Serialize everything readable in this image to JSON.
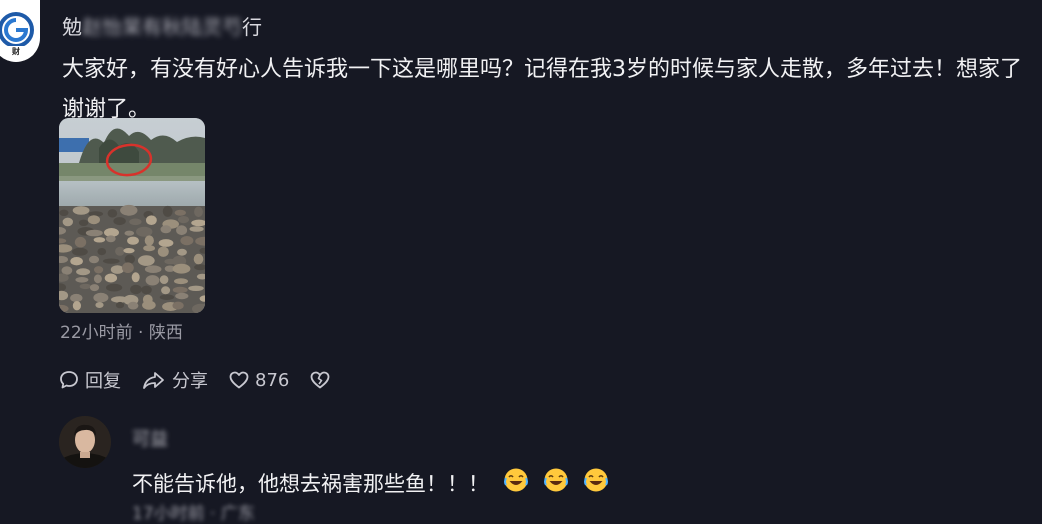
{
  "post": {
    "username_clear": "勉",
    "username_blurred": "赵怡杲有秋陆灵芍",
    "username_tail": "行",
    "text_line1": "大家好，有没有好心人告诉我一下这是哪里吗？记得在我3岁的时候与家人走散，多年过去！想家了",
    "text_line2": "谢谢了。",
    "meta": "22小时前 · 陕西",
    "image_icon": "riverbank-photo-with-red-circle"
  },
  "actions": {
    "reply_label": "回复",
    "share_label": "分享",
    "like_count": "876",
    "reply_icon": "speech-bubble-icon",
    "share_icon": "share-arrow-icon",
    "like_icon": "heart-outline-icon",
    "dislike_icon": "broken-heart-icon"
  },
  "reply": {
    "name": "可益",
    "text": "不能告诉他，他想去祸害那些鱼！！！",
    "emoji_count": 3,
    "meta": "17小时前 · 广东"
  },
  "colors": {
    "background": "#161823",
    "text_primary": "#f1f1f3",
    "text_meta": "#9a9aa4",
    "logo_blue": "#1e5aa8"
  }
}
